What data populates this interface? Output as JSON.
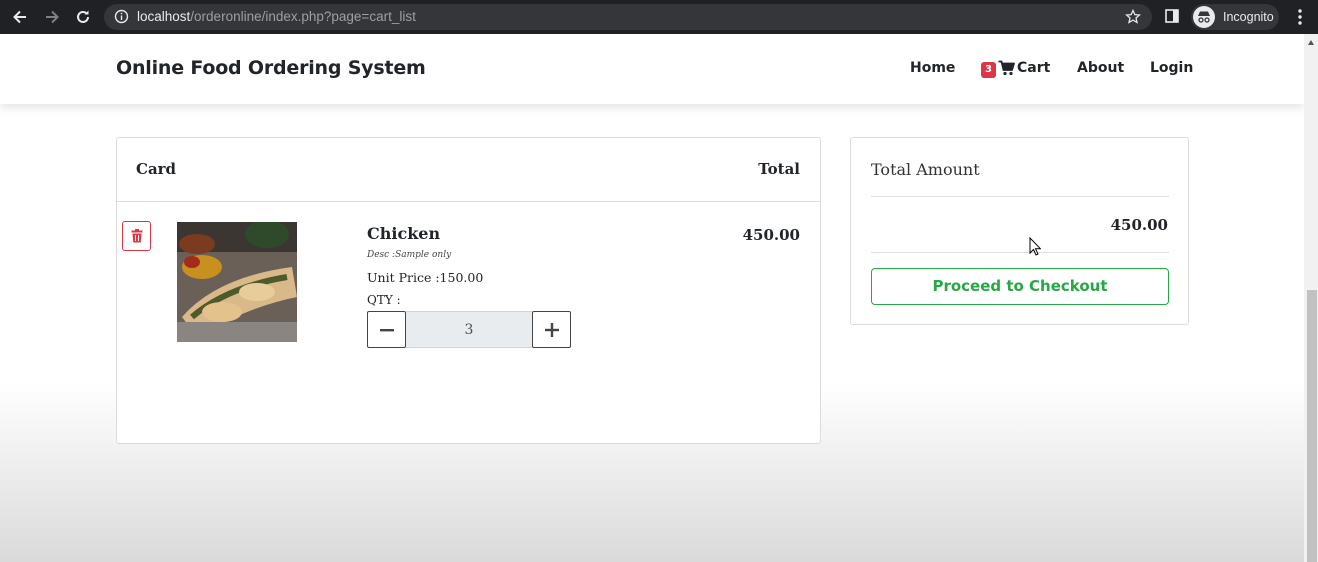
{
  "browser": {
    "url_host": "localhost",
    "url_path": "/orderonline/index.php?page=cart_list",
    "profile_label": "Incognito",
    "icons": [
      "back-arrow-icon",
      "forward-arrow-icon",
      "reload-icon",
      "info-icon",
      "star-icon",
      "sidebar-icon",
      "incognito-icon",
      "menu-dots-icon"
    ]
  },
  "navbar": {
    "brand": "Online Food Ordering System",
    "links": {
      "home": "Home",
      "cart": "Cart",
      "about": "About",
      "login": "Login"
    },
    "cart_count": "3"
  },
  "cart": {
    "header_left": "Card",
    "header_right": "Total",
    "items": [
      {
        "name": "Chicken",
        "desc": "Desc :Sample only",
        "unit_price": "Unit Price :150.00",
        "qty_label": "QTY :",
        "qty": "3",
        "total": "450.00"
      }
    ]
  },
  "summary": {
    "title": "Total Amount",
    "amount": "450.00",
    "checkout_label": "Proceed to Checkout"
  },
  "colors": {
    "chrome_bg": "#202124",
    "accent_green": "#28a745",
    "danger_red": "#dc3545"
  }
}
